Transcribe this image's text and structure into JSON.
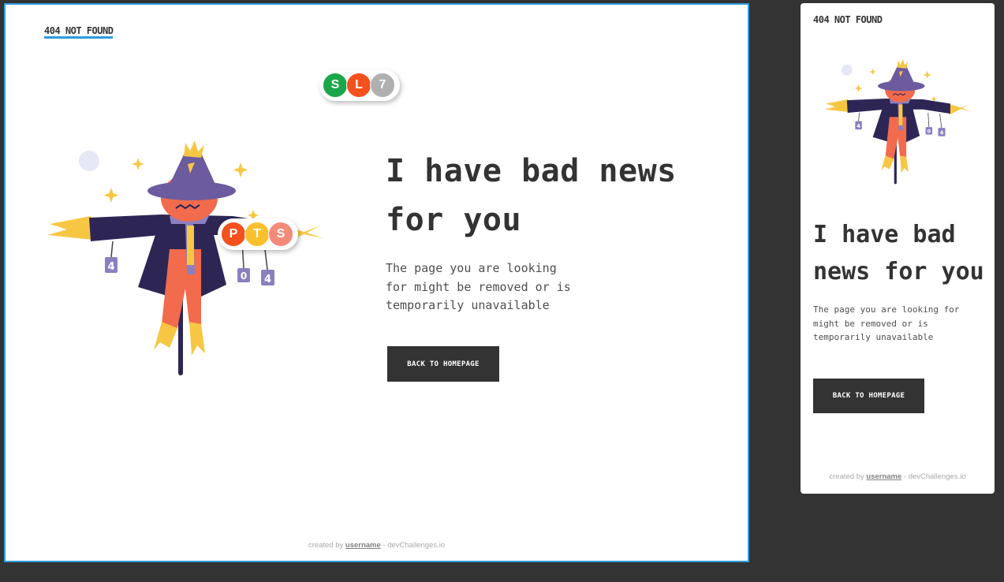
{
  "desktop": {
    "brand": "404 NOT FOUND",
    "headline": "I have bad news for you",
    "description": "The page you are looking for might be removed or is temporarily unavailable",
    "button_label": "BACK TO HOMEPAGE",
    "footer": {
      "prefix": "created by ",
      "username": "username",
      "suffix": " - devChallenges.io"
    },
    "top_badges": [
      {
        "letter": "S",
        "color": "#1aa64a"
      },
      {
        "letter": "L",
        "color": "#f4511e"
      },
      {
        "letter": "7",
        "color": "#b0b0b0"
      }
    ],
    "overlay_badges": [
      {
        "letter": "P",
        "color": "#f4511e"
      },
      {
        "letter": "T",
        "color": "#fbc02d"
      },
      {
        "letter": "S",
        "color": "#f48a7a"
      }
    ]
  },
  "mobile": {
    "brand": "404 NOT FOUND",
    "headline": "I have bad news for you",
    "description": "The page you are looking for might be removed or is temporarily unavailable",
    "button_label": "BACK TO HOMEPAGE",
    "footer": {
      "prefix": "created by ",
      "username": "username",
      "suffix": " - devChallenges.io"
    }
  },
  "illustration": {
    "can_labels": [
      "4",
      "0",
      "4"
    ],
    "colors": {
      "hat": "#6c5b9e",
      "coat": "#2d2655",
      "face": "#f26b4c",
      "straw": "#f7c744",
      "scarf": "#8b7fc0",
      "pole": "#2d2655"
    }
  },
  "colors": {
    "accent": "#2d9cdb",
    "dark": "#333333",
    "background": "#333333"
  }
}
